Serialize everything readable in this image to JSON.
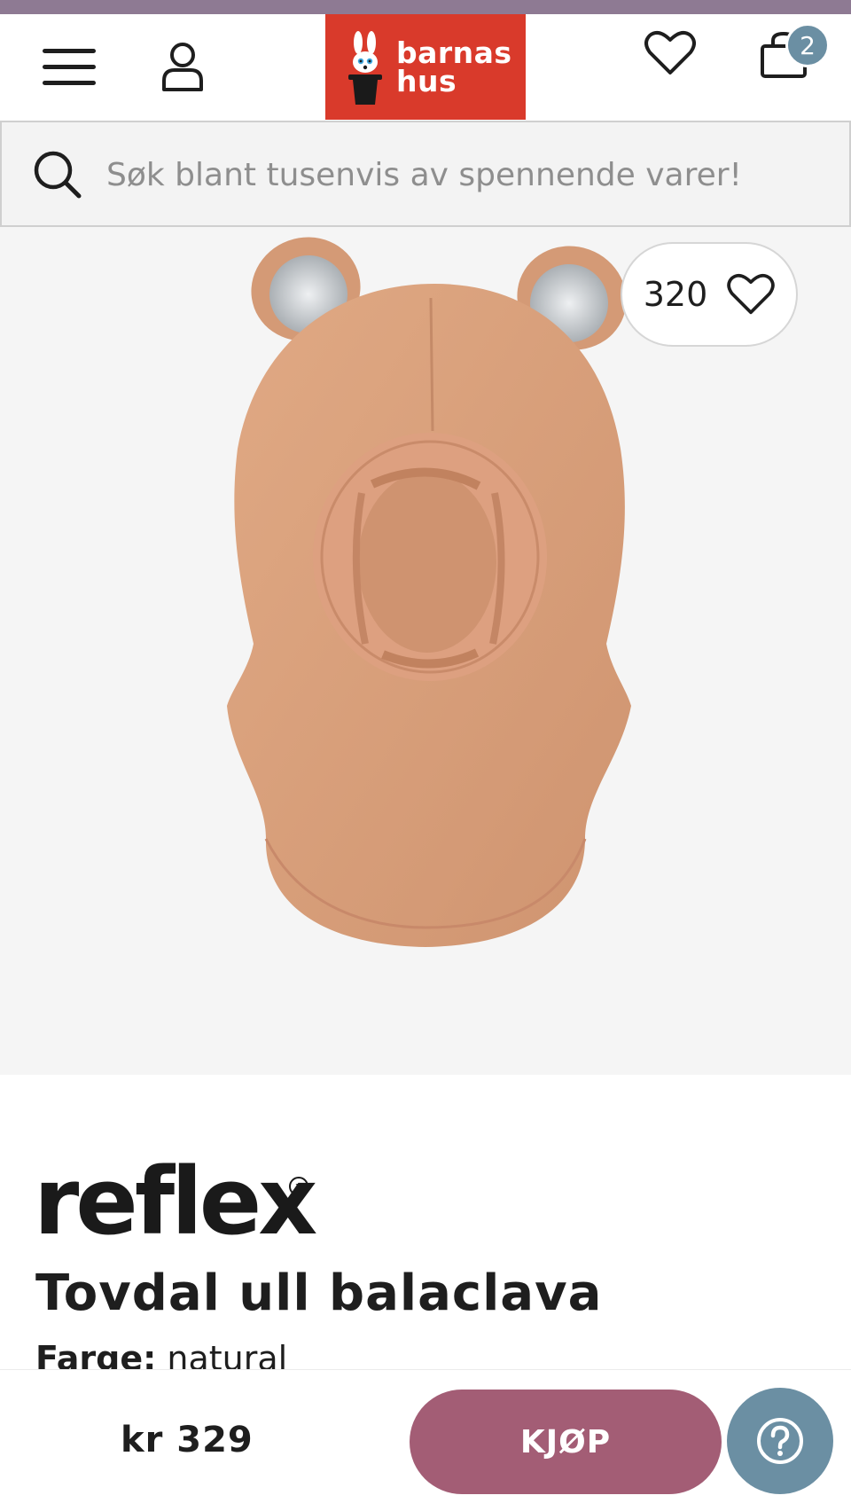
{
  "header": {
    "logo_line1": "barnas",
    "logo_line2": "hus",
    "cart_count": "2",
    "icons": {
      "menu": "hamburger-menu-icon",
      "account": "user-icon",
      "wishlist": "heart-icon",
      "cart": "shopping-bag-icon"
    }
  },
  "search": {
    "placeholder": "Søk blant tusenvis av spennende varer!",
    "icon": "search-icon"
  },
  "product": {
    "like_count": "320",
    "brand": "reflex",
    "brand_mark": "™",
    "title": "Tovdal ull balaclava",
    "color_label": "Farge:",
    "color_value": "natural",
    "image_alt": "Tovdal ull balaclava i natural farge med ører"
  },
  "purchase": {
    "price": "kr 329",
    "buy_label": "KJØP",
    "help_icon": "question-mark-icon"
  },
  "colors": {
    "top_strip": "#8e7a93",
    "logo_bg": "#d93a2b",
    "badge": "#6b8fa3",
    "buy_button": "#a35d75",
    "help_button": "#6b8fa3",
    "product_fleece": "#d9a07b"
  }
}
